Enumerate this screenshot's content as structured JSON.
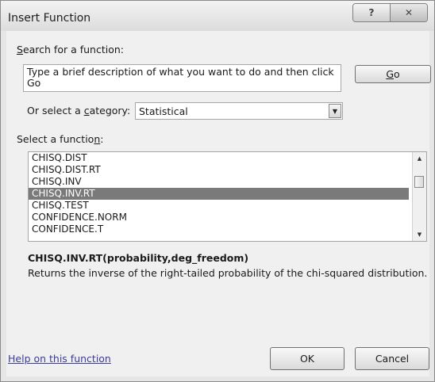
{
  "window": {
    "title": "Insert Function",
    "help_button": "?",
    "close_button": "✕"
  },
  "search": {
    "label_prefix": "",
    "label_access": "S",
    "label_rest": "earch for a function:",
    "textbox_value": "Type a brief description of what you want to do and then click Go",
    "go_access": "G",
    "go_rest": "o"
  },
  "category": {
    "label_pre": "Or select a ",
    "label_access": "c",
    "label_post": "ategory:",
    "selected": "Statistical"
  },
  "functions": {
    "label_pre": "Select a functio",
    "label_access": "n",
    "label_post": ":",
    "items": [
      "CHISQ.DIST",
      "CHISQ.DIST.RT",
      "CHISQ.INV",
      "CHISQ.INV.RT",
      "CHISQ.TEST",
      "CONFIDENCE.NORM",
      "CONFIDENCE.T"
    ],
    "selected_index": 3
  },
  "details": {
    "signature": "CHISQ.INV.RT(probability,deg_freedom)",
    "description": "Returns the inverse of the right-tailed probability of the chi-squared distribution."
  },
  "footer": {
    "help_link": "Help on this function",
    "ok_label": "OK",
    "cancel_label": "Cancel"
  }
}
